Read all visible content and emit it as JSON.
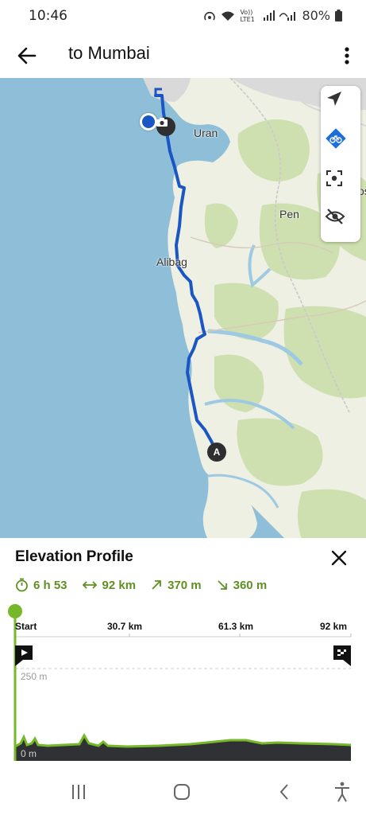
{
  "status": {
    "time": "10:46",
    "battery": "80%",
    "network": "Vo)) LTE1"
  },
  "header": {
    "title": "to Mumbai"
  },
  "map": {
    "labels": {
      "uran": "Uran",
      "pen": "Pen",
      "alibag": "Alibag",
      "edge": "vos"
    },
    "start_marker": "A",
    "colors": {
      "sea": "#8fbfd8",
      "land": "#eef0e4",
      "forest": "#cfe0b0",
      "route": "#1a56c4"
    }
  },
  "elevation": {
    "title": "Elevation Profile",
    "stats": {
      "duration": "6 h 53",
      "distance": "92 km",
      "ascent": "370 m",
      "descent": "360 m"
    },
    "axis": {
      "start": "Start",
      "m1": "30.7 km",
      "m2": "61.3 km",
      "end": "92 km"
    },
    "y_labels": {
      "top": "250 m",
      "bottom": "0 m"
    },
    "accent": "#76b82a"
  }
}
